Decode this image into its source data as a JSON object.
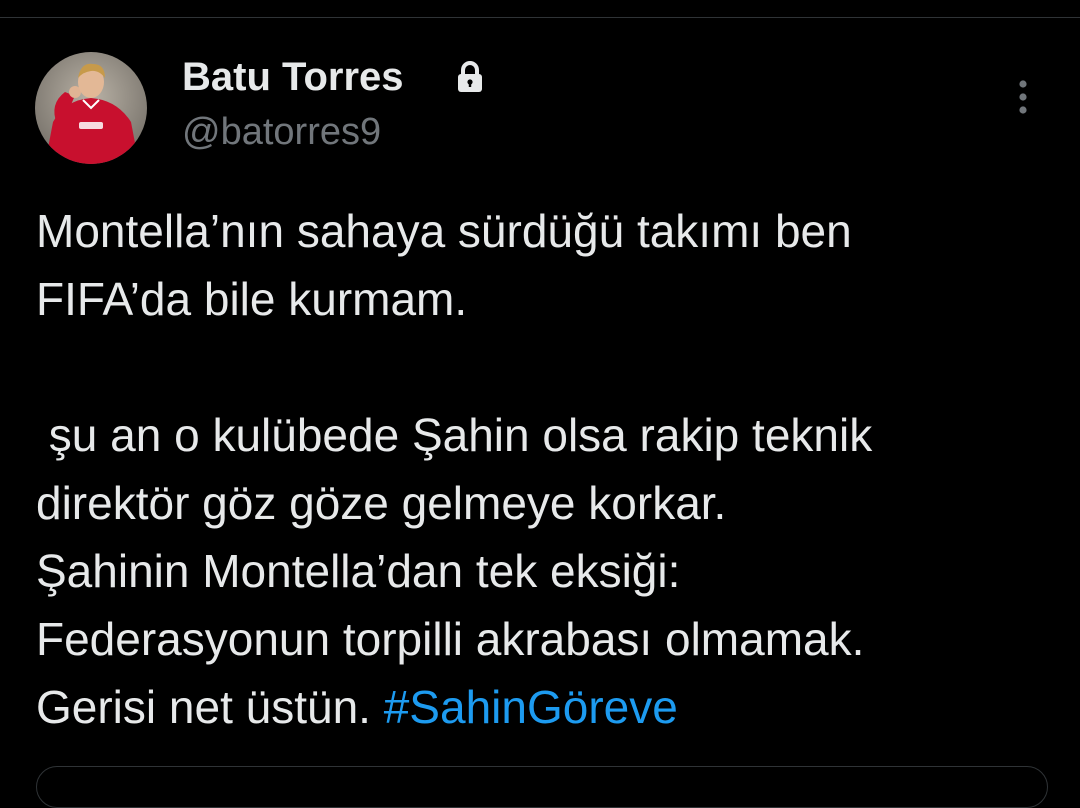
{
  "tweet": {
    "author": {
      "display_name": "Batu Torres",
      "handle": "@batorres9",
      "protected_icon": "lock-icon",
      "avatar_icon": "profile-photo-footballer"
    },
    "more_icon": "more-vertical-icon",
    "text_lines": [
      "Montella’nın sahaya sürdüğü takımı ben",
      "FIFA’da bile kurmam.",
      "",
      " şu an o kulübede Şahin olsa rakip teknik",
      "direktör göz göze gelmeye korkar.",
      "Şahinin Montella’dan tek eksiği:",
      "Federasyonun torpilli akrabası olmamak."
    ],
    "last_line_text": "Gerisi net üstün. ",
    "hashtag": "#SahinGöreve"
  },
  "colors": {
    "background": "#000000",
    "text_primary": "#e7e9ea",
    "text_secondary": "#71767b",
    "link": "#1d9bf0",
    "divider": "#2f3336"
  }
}
